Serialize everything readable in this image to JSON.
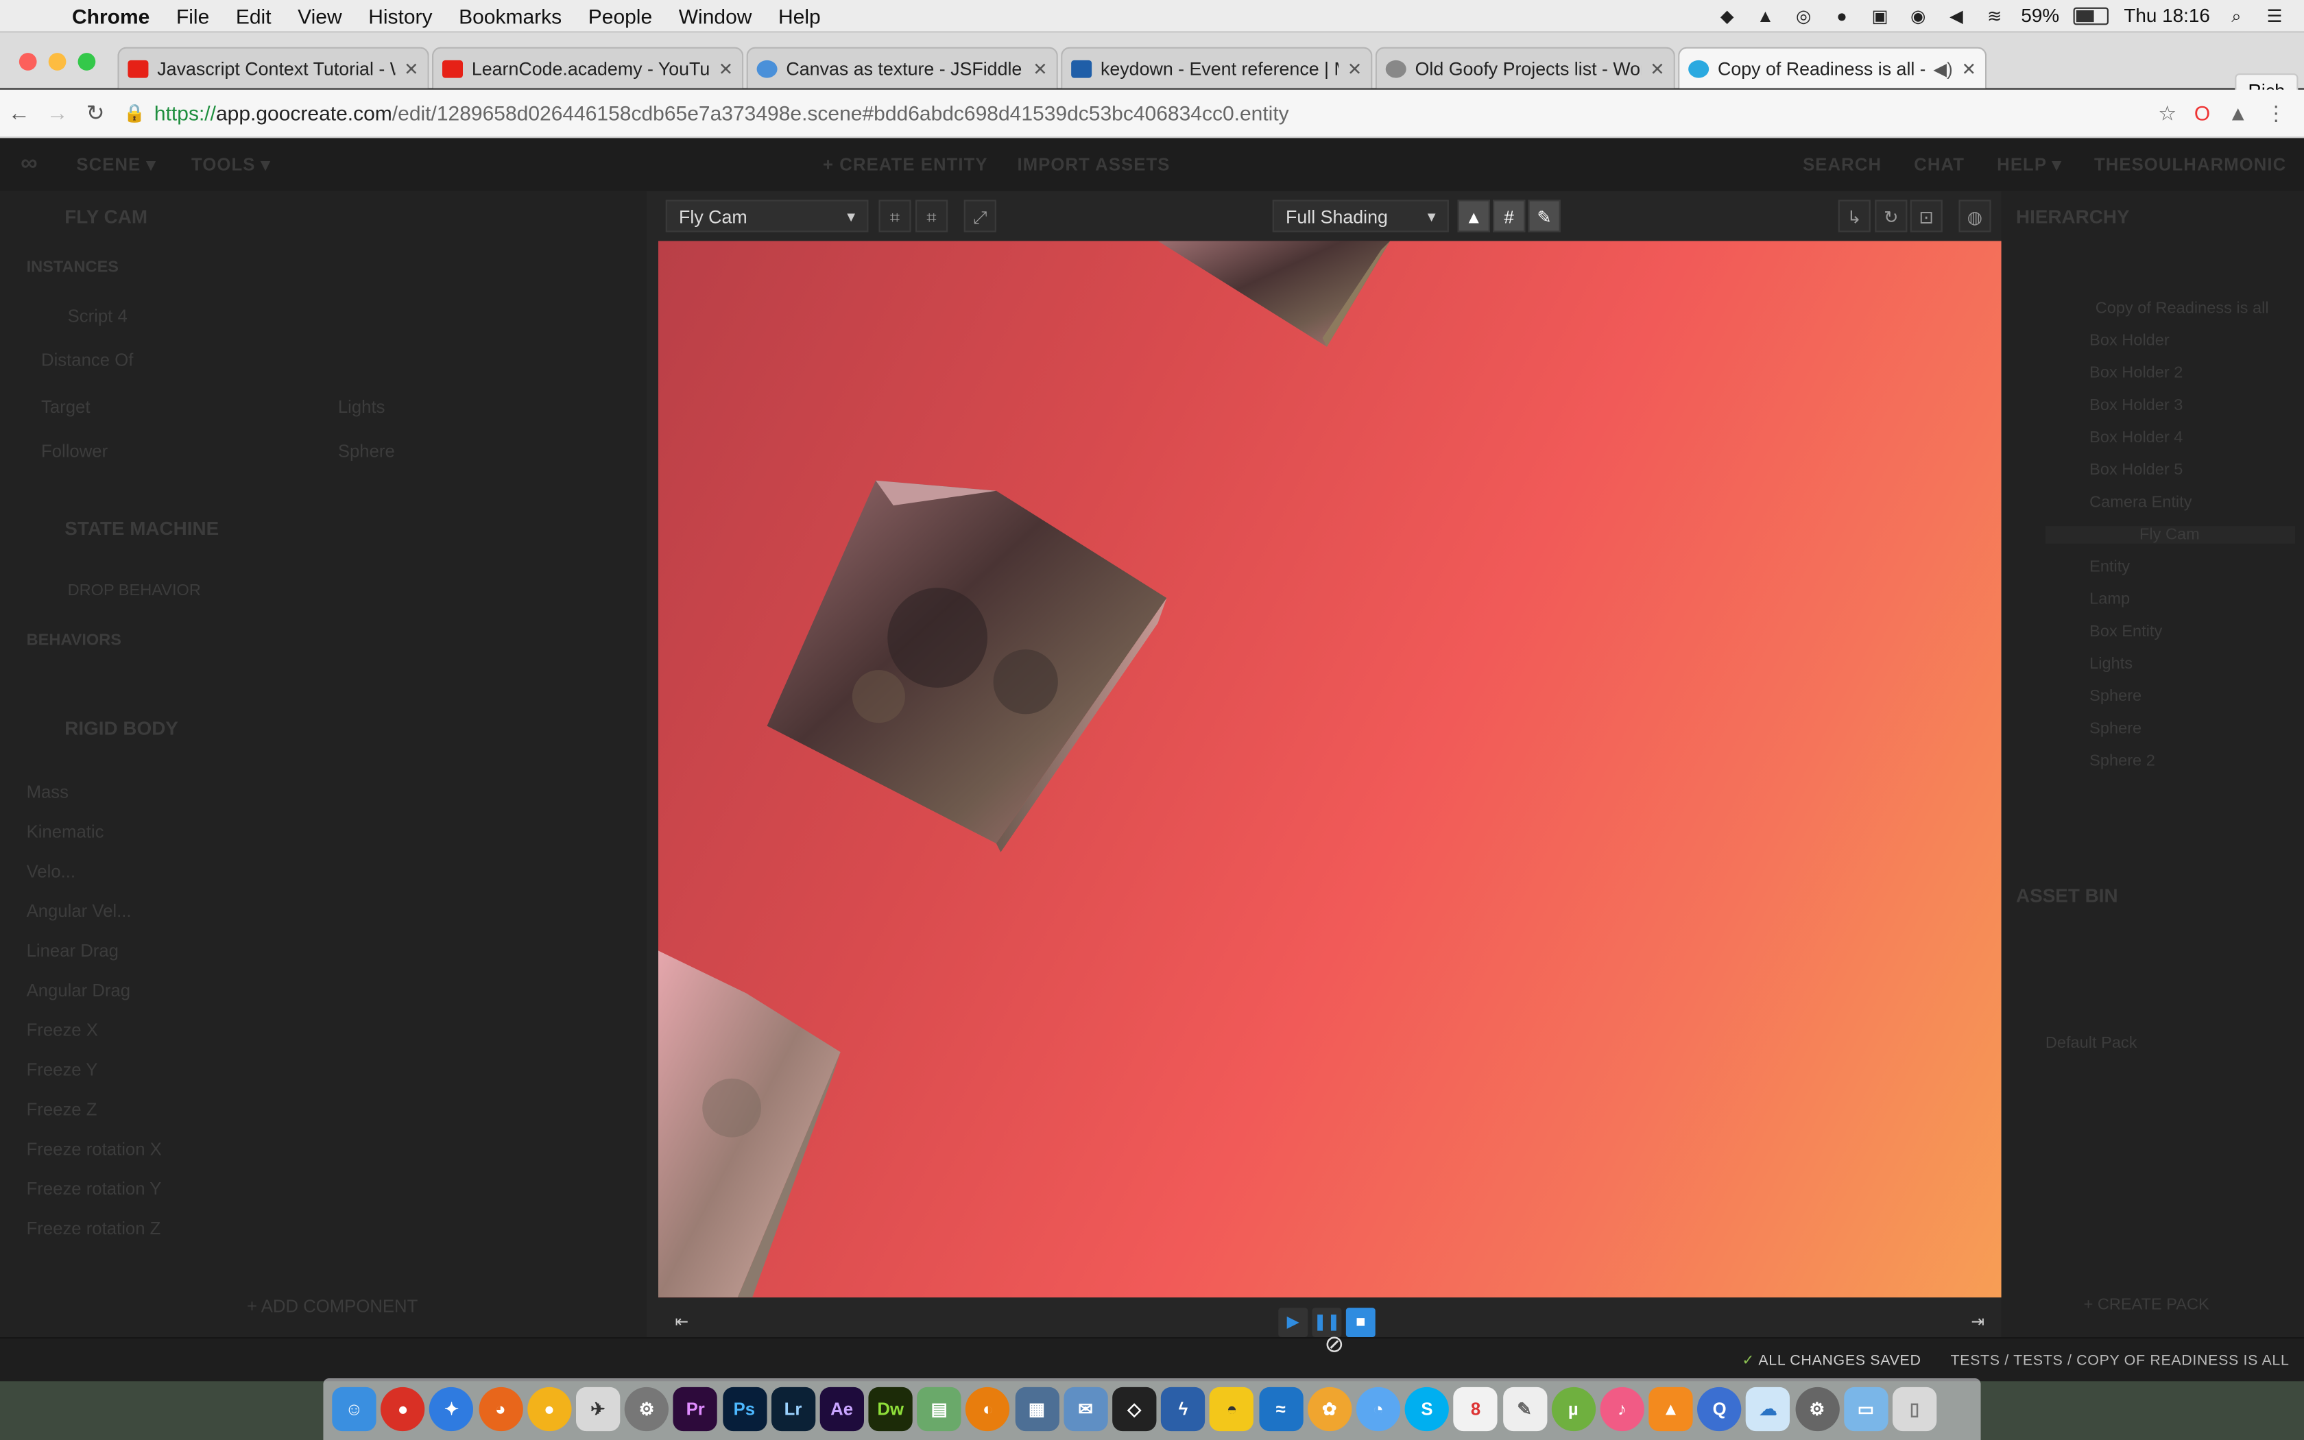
{
  "menubar": {
    "app": "Chrome",
    "items": [
      "File",
      "Edit",
      "View",
      "History",
      "Bookmarks",
      "People",
      "Window",
      "Help"
    ],
    "battery": "59%",
    "clock": "Thu 18:16"
  },
  "tabs": [
    {
      "title": "Javascript Context Tutorial - W",
      "favicon_color": "#e62117"
    },
    {
      "title": "LearnCode.academy - YouTub",
      "favicon_color": "#e62117"
    },
    {
      "title": "Canvas as texture - JSFiddle",
      "favicon_color": "#4a90d9"
    },
    {
      "title": "keydown - Event reference | M",
      "favicon_color": "#1f5ea8"
    },
    {
      "title": "Old Goofy Projects list - Work",
      "favicon_color": "#666666"
    },
    {
      "title": "Copy of Readiness is all - G",
      "favicon_color": "#2aa9e0"
    }
  ],
  "profile_name": "Rich",
  "address": {
    "scheme": "https://",
    "host": "app.goocreate.com",
    "path": "/edit/1289658d026446158cdb65e7a373498e.scene#bdd6abdc698d41539dc53bc406834cc0.entity"
  },
  "appbar": {
    "left": [
      "SCENE ▾",
      "TOOLS ▾"
    ],
    "center": [
      "+ CREATE ENTITY",
      "IMPORT ASSETS"
    ],
    "right": [
      "SEARCH",
      "CHAT",
      "HELP ▾",
      "THESOULHARMONIC"
    ]
  },
  "left_panel": {
    "component_title": "FLY CAM",
    "instances": "INSTANCES",
    "script": "Script 4",
    "fields": [
      "Distance Of",
      "Target",
      "Follower"
    ],
    "field_values": [
      "",
      "Lights",
      "Sphere"
    ],
    "state_machine": "STATE MACHINE",
    "drop_behavior": "DROP BEHAVIOR",
    "behaviors": "BEHAVIORS",
    "rigid_body": "RIGID BODY",
    "rb_fields": [
      "Mass",
      "Kinematic",
      "Velo...",
      "Angular Vel...",
      "Linear Drag",
      "Angular Drag",
      "Freeze X",
      "Freeze Y",
      "Freeze Z",
      "Freeze rotation X",
      "Freeze rotation Y",
      "Freeze rotation Z"
    ],
    "add_component": "+ ADD COMPONENT"
  },
  "right_panel": {
    "hierarchy": "HIERARCHY",
    "root": "Copy of Readiness is all",
    "items": [
      "Box Holder",
      "Box Holder 2",
      "Box Holder 3",
      "Box Holder 4",
      "Box Holder 5",
      "Camera Entity",
      "Fly Cam",
      "Entity",
      "Lamp",
      "Box Entity",
      "Lights",
      "Sphere",
      "Sphere",
      "Sphere 2"
    ],
    "asset_bin": "ASSET BIN",
    "default_pack": "Default Pack",
    "create_pack": "+ CREATE PACK"
  },
  "viewport": {
    "camera_select": "Fly Cam",
    "shading_select": "Full Shading"
  },
  "status": {
    "saved": "ALL CHANGES SAVED",
    "breadcrumb": "TESTS / TESTS / COPY OF READINESS IS ALL"
  },
  "colors": {
    "gradient_start": "#b93f47",
    "gradient_mid": "#f15a58",
    "gradient_end": "#f79e55",
    "play_blue": "#2f8ce0"
  }
}
